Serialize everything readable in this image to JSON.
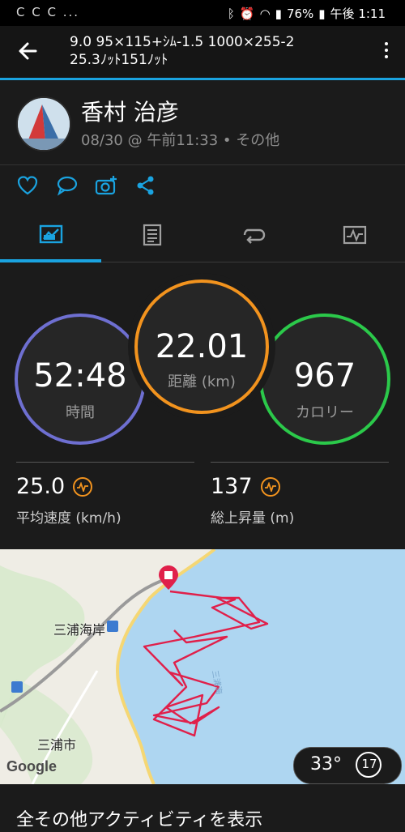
{
  "status": {
    "left_icons": "C C C ...",
    "battery": "76%",
    "time": "午後 1:11"
  },
  "header": {
    "title_line1": "9.0 95×115+ｼﾑ-1.5 1000×255-2",
    "title_line2": "25.3ﾉｯﾄ151ﾉｯﾄ"
  },
  "profile": {
    "name": "香村 治彦",
    "meta": "08/30 @ 午前11:33 • その他"
  },
  "stats": {
    "time": {
      "value": "52:48",
      "label": "時間"
    },
    "distance": {
      "value": "22.01",
      "label": "距離 (km)"
    },
    "calories": {
      "value": "967",
      "label": "カロリー"
    },
    "avg_speed": {
      "value": "25.0",
      "label": "平均速度 (km/h)"
    },
    "elevation_gain": {
      "value": "137",
      "label": "総上昇量 (m)"
    }
  },
  "map": {
    "place_station": "三浦海岸",
    "place_city": "三浦市",
    "google": "Google",
    "temperature": "33°",
    "wind": "17"
  },
  "footer": {
    "link": "全その他アクティビティを表示"
  },
  "colors": {
    "accent": "#1aa3e0",
    "time_ring": "#6e6fd1",
    "distance_ring": "#f2931e",
    "calories_ring": "#2bc94a",
    "track": "#e0204a"
  }
}
